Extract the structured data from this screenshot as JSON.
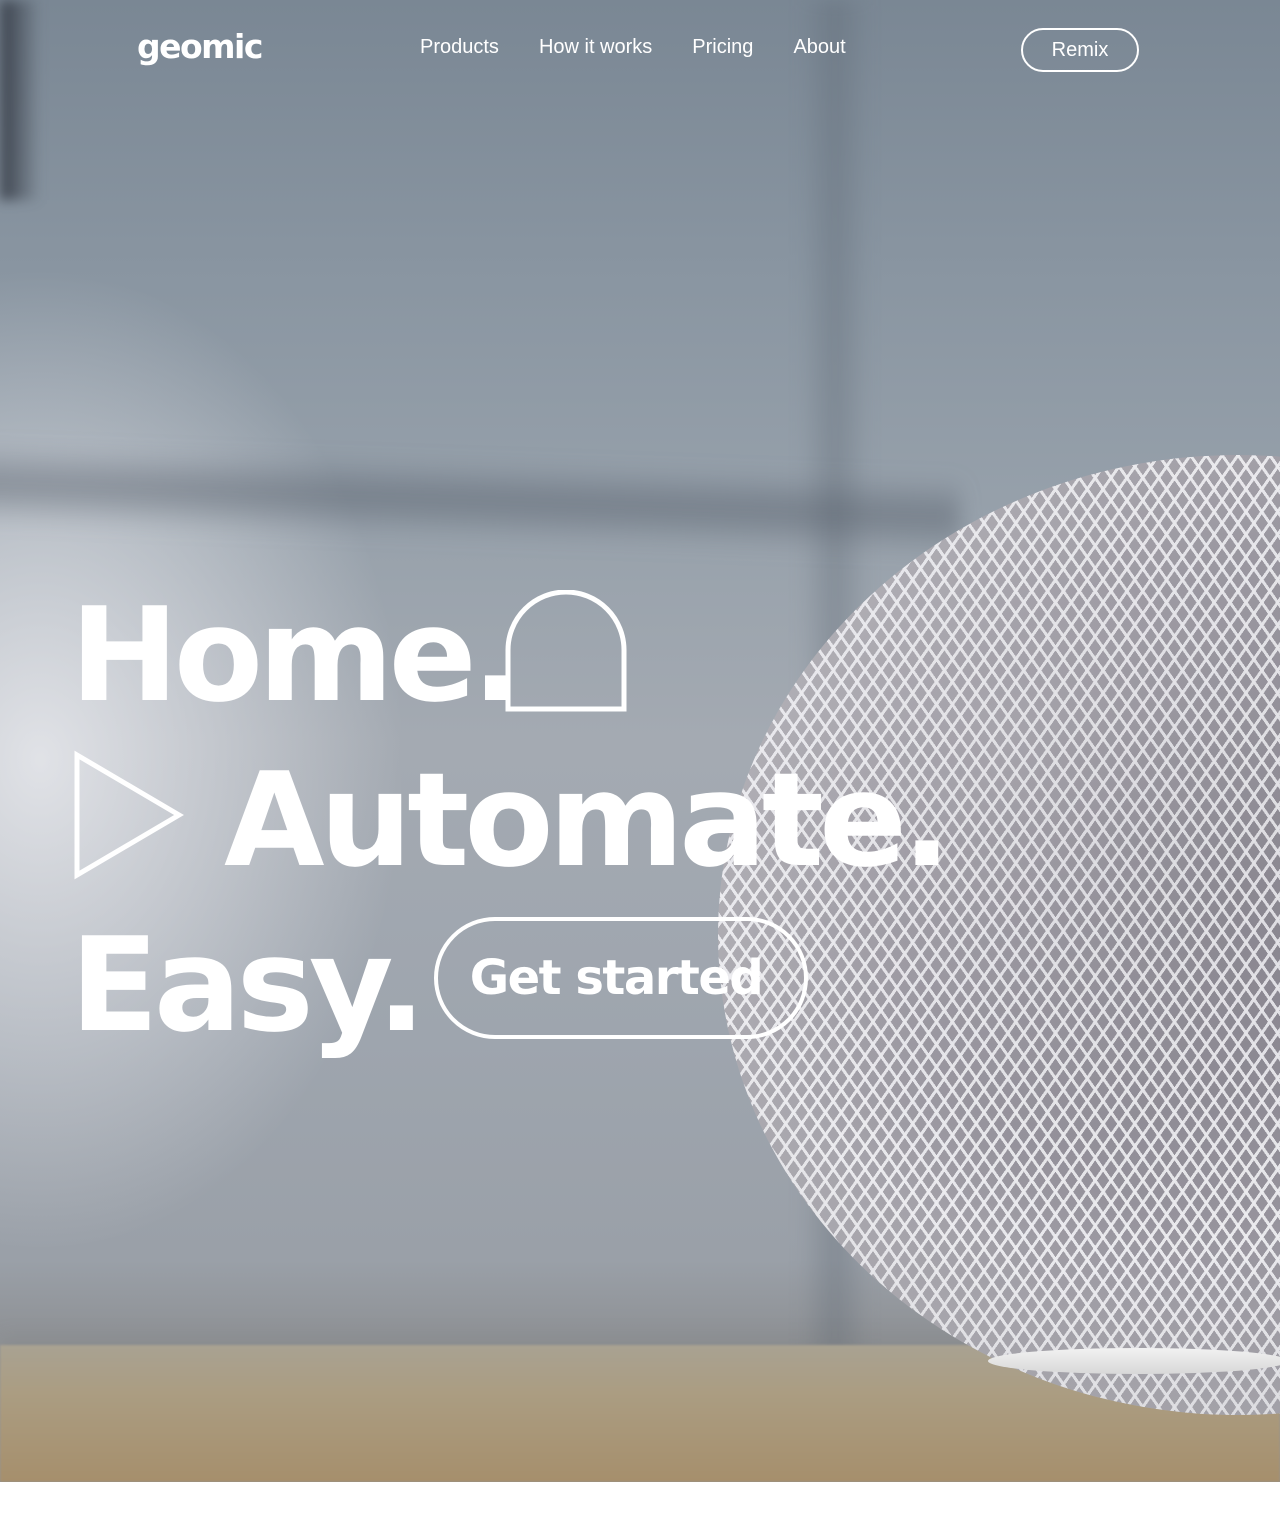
{
  "brand": {
    "logo_text": "geomic"
  },
  "nav": {
    "links": [
      {
        "label": "Products"
      },
      {
        "label": "How it works"
      },
      {
        "label": "Pricing"
      },
      {
        "label": "About"
      }
    ],
    "remix_label": "Remix"
  },
  "hero": {
    "line1": "Home.",
    "line2": "Automate.",
    "line3": "Easy.",
    "cta_label": "Get started",
    "background_subject": "smart-speaker-photo"
  },
  "colors": {
    "text": "#ffffff",
    "background": "#9aa3ad",
    "table": "#a68f6c"
  },
  "icons": {
    "arch": "arch-outline-icon",
    "triangle": "play-triangle-outline-icon"
  }
}
